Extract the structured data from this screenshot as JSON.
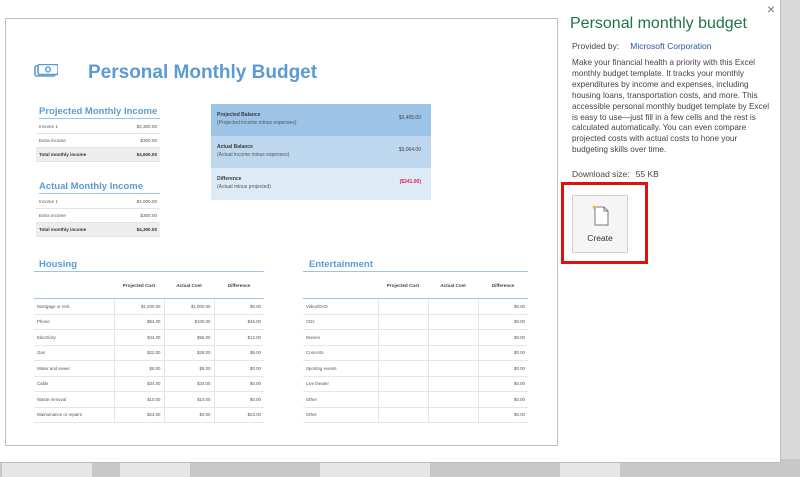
{
  "dialog": {
    "close_label": "×"
  },
  "template": {
    "title": "Personal Monthly Budget",
    "projected_income": {
      "heading": "Projected Monthly Income",
      "rows": [
        {
          "label": "Income 1",
          "value": "$4,300.00"
        },
        {
          "label": "Extra income",
          "value": "$300.00"
        },
        {
          "label": "Total monthly income",
          "value": "$4,600.00"
        }
      ]
    },
    "actual_income": {
      "heading": "Actual Monthly Income",
      "rows": [
        {
          "label": "Income 1",
          "value": "$4,000.00"
        },
        {
          "label": "Extra income",
          "value": "$300.00"
        },
        {
          "label": "Total monthly income",
          "value": "$4,300.00"
        }
      ]
    },
    "balance": {
      "rows": [
        {
          "label": "Projected Balance",
          "sub": "(Projected income minus expenses)",
          "value": "$3,405.00"
        },
        {
          "label": "Actual Balance",
          "sub": "(Actual income minus expenses)",
          "value": "$3,064.00"
        },
        {
          "label": "Difference",
          "sub": "(Actual minus projected)",
          "value": "($341.00)"
        }
      ],
      "colors": [
        "#9dc3e6",
        "#bdd7ee",
        "#ddebf7"
      ],
      "negative_color": "#e0204a"
    },
    "housing": {
      "heading": "Housing",
      "columns": [
        "Projected Cost",
        "Actual Cost",
        "Difference"
      ],
      "rows": [
        {
          "label": "Mortgage or rent",
          "projected": "$1,000.00",
          "actual": "$1,000.00",
          "difference": "$0.00"
        },
        {
          "label": "Phone",
          "projected": "$54.00",
          "actual": "$100.00",
          "difference": "$46.00"
        },
        {
          "label": "Electricity",
          "projected": "$44.00",
          "actual": "$56.00",
          "difference": "$12.00"
        },
        {
          "label": "Gas",
          "projected": "$22.00",
          "actual": "$28.00",
          "difference": "$6.00"
        },
        {
          "label": "Water and sewer",
          "projected": "$8.00",
          "actual": "$8.00",
          "difference": "$0.00"
        },
        {
          "label": "Cable",
          "projected": "$34.00",
          "actual": "$34.00",
          "difference": "$0.00"
        },
        {
          "label": "Waste removal",
          "projected": "$10.00",
          "actual": "$10.00",
          "difference": "$0.00"
        },
        {
          "label": "Maintenance or repairs",
          "projected": "$23.00",
          "actual": "$0.00",
          "difference": "$23.00"
        }
      ]
    },
    "entertainment": {
      "heading": "Entertainment",
      "columns": [
        "Projected Cost",
        "Actual Cost",
        "Difference"
      ],
      "rows": [
        {
          "label": "Video/DVD",
          "projected": "",
          "actual": "",
          "difference": "$0.00"
        },
        {
          "label": "CDs",
          "projected": "",
          "actual": "",
          "difference": "$0.00"
        },
        {
          "label": "Movies",
          "projected": "",
          "actual": "",
          "difference": "$0.00"
        },
        {
          "label": "Concerts",
          "projected": "",
          "actual": "",
          "difference": "$0.00"
        },
        {
          "label": "Sporting events",
          "projected": "",
          "actual": "",
          "difference": "$0.00"
        },
        {
          "label": "Live theater",
          "projected": "",
          "actual": "",
          "difference": "$0.00"
        },
        {
          "label": "Other",
          "projected": "",
          "actual": "",
          "difference": "$0.00"
        },
        {
          "label": "Other",
          "projected": "",
          "actual": "",
          "difference": "$0.00"
        }
      ]
    }
  },
  "panel": {
    "title": "Personal monthly budget",
    "provided_label": "Provided by:",
    "provider": "Microsoft Corporation",
    "description": "Make your financial health a priority with this Excel monthly budget template. It tracks your monthly expenditures by income and expenses, including housing loans, transportation costs, and more. This accessible personal monthly budget template by Excel is easy to use—just fill in a few cells and the rest is calculated automatically. You can even compare projected costs with actual costs to hone your budgeting skills over time.",
    "download_label": "Download size:",
    "download_size": "55 KB",
    "create_label": "Create",
    "create_icon": "new-document-icon",
    "accent_color": "#217346",
    "highlight_color": "#e01010"
  }
}
